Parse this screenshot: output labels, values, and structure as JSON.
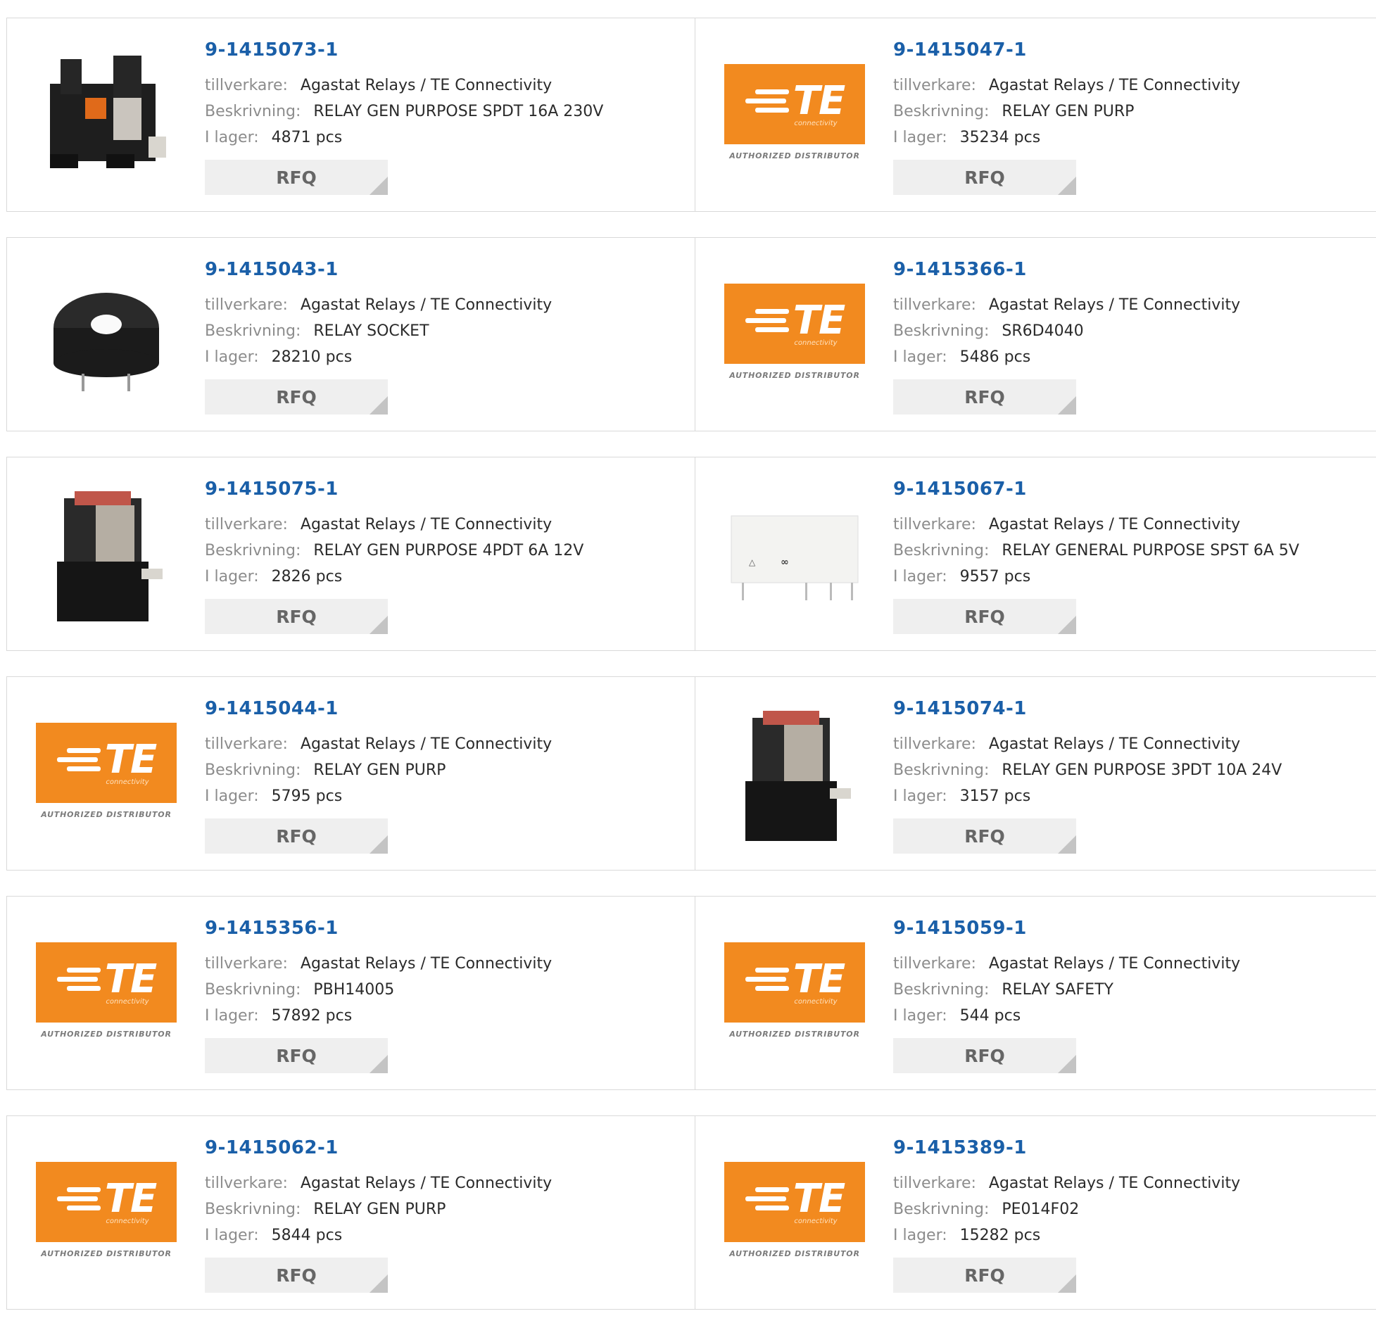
{
  "labels": {
    "manufacturer": "tillverkare:",
    "description": "Beskrivning:",
    "stock": "I lager:",
    "rfq": "RFQ"
  },
  "logo": {
    "letters": "TE",
    "sub": "connectivity",
    "authorized": "AUTHORIZED DISTRIBUTOR",
    "brand_color": "#f28a1f"
  },
  "products": [
    {
      "part": "9-1415073-1",
      "manufacturer": "Agastat Relays / TE Connectivity",
      "description": "RELAY GEN PURPOSE SPDT 16A 230V",
      "stock": "4871 pcs",
      "image": "relay-din-socket-photo"
    },
    {
      "part": "9-1415047-1",
      "manufacturer": "Agastat Relays / TE Connectivity",
      "description": "RELAY GEN PURP",
      "stock": "35234 pcs",
      "image": "te-logo"
    },
    {
      "part": "9-1415043-1",
      "manufacturer": "Agastat Relays / TE Connectivity",
      "description": "RELAY SOCKET",
      "stock": "28210 pcs",
      "image": "round-socket-photo"
    },
    {
      "part": "9-1415366-1",
      "manufacturer": "Agastat Relays / TE Connectivity",
      "description": "SR6D4040",
      "stock": "5486 pcs",
      "image": "te-logo"
    },
    {
      "part": "9-1415075-1",
      "manufacturer": "Agastat Relays / TE Connectivity",
      "description": "RELAY GEN PURPOSE 4PDT 6A 12V",
      "stock": "2826 pcs",
      "image": "relay-socket-photo"
    },
    {
      "part": "9-1415067-1",
      "manufacturer": "Agastat Relays / TE Connectivity",
      "description": "RELAY GENERAL PURPOSE SPST 6A 5V",
      "stock": "9557 pcs",
      "image": "pcb-relay-photo"
    },
    {
      "part": "9-1415044-1",
      "manufacturer": "Agastat Relays / TE Connectivity",
      "description": "RELAY GEN PURP",
      "stock": "5795 pcs",
      "image": "te-logo"
    },
    {
      "part": "9-1415074-1",
      "manufacturer": "Agastat Relays / TE Connectivity",
      "description": "RELAY GEN PURPOSE 3PDT 10A 24V",
      "stock": "3157 pcs",
      "image": "relay-socket-photo"
    },
    {
      "part": "9-1415356-1",
      "manufacturer": "Agastat Relays / TE Connectivity",
      "description": "PBH14005",
      "stock": "57892 pcs",
      "image": "te-logo"
    },
    {
      "part": "9-1415059-1",
      "manufacturer": "Agastat Relays / TE Connectivity",
      "description": "RELAY SAFETY",
      "stock": "544 pcs",
      "image": "te-logo"
    },
    {
      "part": "9-1415062-1",
      "manufacturer": "Agastat Relays / TE Connectivity",
      "description": "RELAY GEN PURP",
      "stock": "5844 pcs",
      "image": "te-logo"
    },
    {
      "part": "9-1415389-1",
      "manufacturer": "Agastat Relays / TE Connectivity",
      "description": "PE014F02",
      "stock": "15282 pcs",
      "image": "te-logo"
    }
  ]
}
